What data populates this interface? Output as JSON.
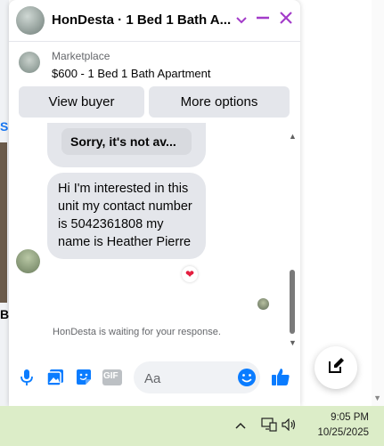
{
  "background": {
    "left_fragment_1": "S",
    "left_fragment_2": "B",
    "accent": "#1877f2"
  },
  "chat": {
    "header": {
      "title": "HonDesta · 1 Bed 1 Bath A...",
      "icons": [
        "chevron-down-icon",
        "minimize-icon",
        "close-icon"
      ],
      "icon_color": "#a33cc9"
    },
    "listing": {
      "source": "Marketplace",
      "title": "$600 - 1 Bed 1 Bath Apartment",
      "view_buyer_label": "View buyer",
      "more_options_label": "More options"
    },
    "messages": {
      "previous_reply": "Sorry, it's not av...",
      "incoming_text": "Hi I'm interested in this unit my contact number is 5042361808 my name is Heather Pierre",
      "reaction": "❤",
      "waiting_text": "HonDesta is waiting for your response."
    },
    "composer": {
      "placeholder": "Aa",
      "icons": [
        "microphone-icon",
        "photo-icon",
        "sticker-icon",
        "gif-icon",
        "emoji-icon",
        "thumbs-up-icon"
      ],
      "gif_label": "GIF",
      "accent": "#0a7cff"
    }
  },
  "taskbar": {
    "time": "9:05 PM",
    "date": "10/25/2025",
    "icons": [
      "chevron-up-icon",
      "network-icon",
      "volume-icon"
    ],
    "background": "#dcedc8"
  }
}
